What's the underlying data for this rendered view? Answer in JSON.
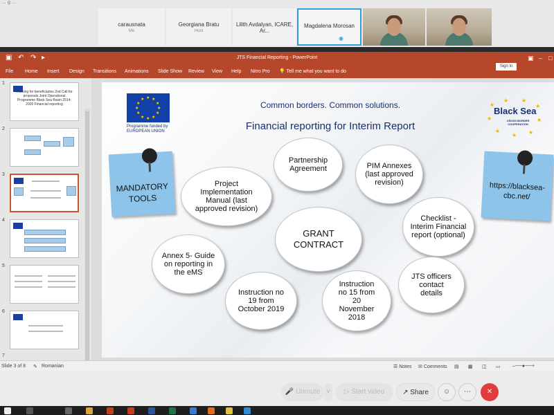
{
  "meeting": {
    "top_title": "… g …",
    "participants": [
      {
        "name": "carausnata",
        "role": "Me"
      },
      {
        "name": "Georgiana Bratu",
        "role": "Host"
      },
      {
        "name": "Lilith Avdalyan, ICARE, Ar...",
        "role": ""
      },
      {
        "name": "Magdalena Morosan",
        "role": ""
      }
    ],
    "controls": {
      "unmute": "Unmute",
      "start_video": "Start video",
      "share": "Share"
    }
  },
  "ppt": {
    "window_title": "JTS Financial Reporting  -  PowerPoint",
    "sign_in": "Sign in",
    "tabs": [
      "File",
      "Home",
      "Insert",
      "Design",
      "Transitions",
      "Animations",
      "Slide Show",
      "Review",
      "View",
      "Help",
      "Nitro Pro"
    ],
    "tell_me": "Tell me what you want to do",
    "status": {
      "slide_of": "Slide 3 of 8",
      "language": "Romanian",
      "notes": "Notes",
      "comments": "Comments"
    }
  },
  "thumbnails": [
    {
      "num": "1",
      "text": "Training for beneficiaries 2nd Call for proposals Joint Operational Programme Black Sea Basin 2014-2020 Financial reporting"
    },
    {
      "num": "2",
      "text": ""
    },
    {
      "num": "3",
      "text": ""
    },
    {
      "num": "4",
      "text": ""
    },
    {
      "num": "5",
      "text": ""
    },
    {
      "num": "6",
      "text": ""
    },
    {
      "num": "7",
      "text": ""
    }
  ],
  "slide": {
    "eu_caption": "Programme funded by EUROPEAN   UNION",
    "slogan": "Common borders. Common solutions.",
    "title": "Financial reporting for Interim Report",
    "logo": {
      "name": "Black Sea",
      "sub": "CROSS BORDER COOPERATION"
    },
    "note_left": "MANDATORY TOOLS",
    "note_right": "https://blacksea-cbc.net/",
    "bubbles": {
      "partnership": "Partnership Agreement",
      "pim": "PIM Annexes (last approved revision)",
      "manual": "Project Implementation Manual (last approved revision)",
      "checklist": "Checklist - Interim Financial report (optional)",
      "grant": "GRANT CONTRACT",
      "annex5": "Annex 5- Guide on reporting in the eMS",
      "jts": "JTS officers contact details",
      "instr19": "Instruction no 19 from October 2019",
      "instr15": "Instruction no 15 from 20 November 2018"
    }
  }
}
